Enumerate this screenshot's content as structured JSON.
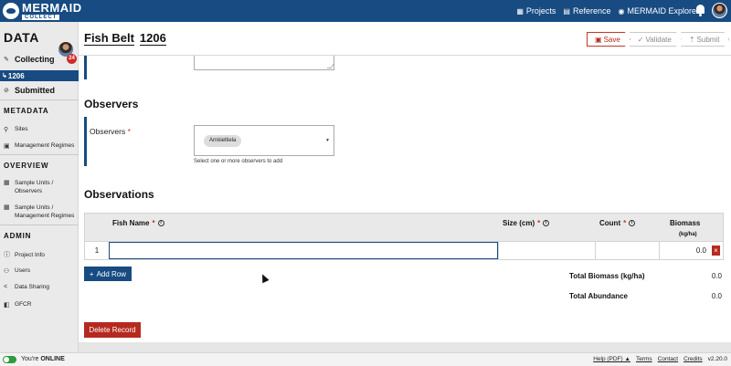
{
  "topbar": {
    "brand_main": "MERMAID",
    "brand_sub": "COLLECT",
    "links": [
      {
        "label": "Projects",
        "icon": "projects-icon"
      },
      {
        "label": "Reference",
        "icon": "reference-icon"
      },
      {
        "label": "MERMAID Explore",
        "icon": "globe-icon"
      }
    ]
  },
  "sidebar": {
    "title": "DATA",
    "badge_count": "24",
    "collecting_label": "Collecting",
    "active_record": "1206",
    "submitted_label": "Submitted",
    "sections": {
      "metadata": "METADATA",
      "overview": "OVERVIEW",
      "admin": "ADMIN"
    },
    "metadata_items": [
      "Sites",
      "Management Regimes"
    ],
    "overview_items": [
      "Sample Units / Observers",
      "Sample Units / Management Regimes"
    ],
    "admin_items": [
      "Project Info",
      "Users",
      "Data Sharing",
      "GFCR"
    ]
  },
  "header": {
    "title_part1": "Fish Belt",
    "title_part2": "1206",
    "save_label": "Save",
    "validate_label": "Validate",
    "submit_label": "Submit"
  },
  "observers": {
    "section_title": "Observers",
    "field_label": "Observers",
    "required_mark": "*",
    "selected_chip": "Arnkieltiela",
    "help_text": "Select one or more observers to add"
  },
  "observations": {
    "section_title": "Observations",
    "columns": {
      "fish_name": "Fish Name",
      "size": "Size (cm)",
      "count": "Count",
      "biomass": "Biomass",
      "biomass_unit": "(kg/ha)"
    },
    "rows": [
      {
        "num": "1",
        "fish_name": "",
        "size": "",
        "count": "",
        "biomass": "0.0"
      }
    ],
    "add_row_label": "Add Row",
    "total_biomass_label": "Total Biomass (kg/ha)",
    "total_biomass_value": "0.0",
    "total_abundance_label": "Total Abundance",
    "total_abundance_value": "0.0",
    "delete_record_label": "Delete Record"
  },
  "footer": {
    "status_prefix": "You're",
    "status_value": "ONLINE",
    "help_label": "Help (PDF)",
    "terms_label": "Terms",
    "contact_label": "Contact",
    "credits_label": "Credits",
    "version": "v2.20.0"
  },
  "colors": {
    "brand_blue": "#174b82",
    "danger_red": "#b52a1f",
    "online_green": "#2e9b3e"
  }
}
